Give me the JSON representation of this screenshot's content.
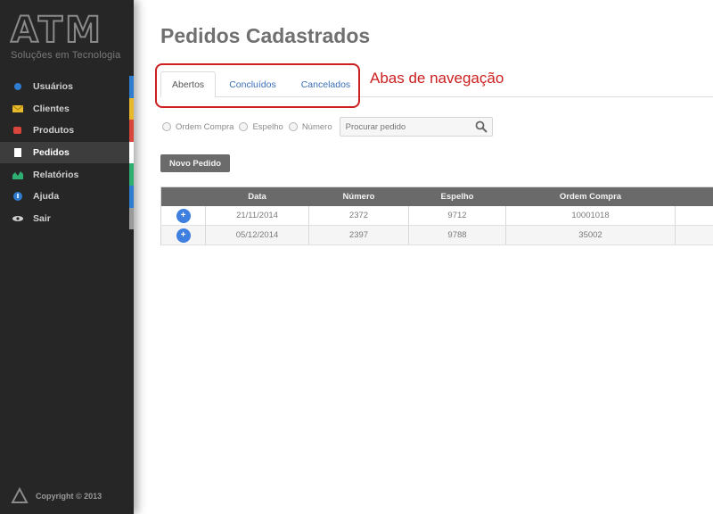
{
  "sidebar": {
    "logo_text": "ATM",
    "logo_subtitle": "Soluções em Tecnologia",
    "items": [
      {
        "label": "Usuários",
        "icon": "user-icon",
        "color": "#2f7dd1",
        "active": false
      },
      {
        "label": "Clientes",
        "icon": "envelope-icon",
        "color": "#e8b92b",
        "active": false
      },
      {
        "label": "Produtos",
        "icon": "tag-icon",
        "color": "#d9463b",
        "active": false
      },
      {
        "label": "Pedidos",
        "icon": "document-icon",
        "color": "#ffffff",
        "active": true
      },
      {
        "label": "Relatórios",
        "icon": "chart-icon",
        "color": "#2fae72",
        "active": false
      },
      {
        "label": "Ajuda",
        "icon": "help-icon",
        "color": "#2f7dd1",
        "active": false
      },
      {
        "label": "Sair",
        "icon": "eye-icon",
        "color": "#9a9a9a",
        "active": false
      }
    ],
    "copyright": "Copyright © 2013"
  },
  "main": {
    "title": "Pedidos Cadastrados",
    "tabs": [
      {
        "label": "Abertos",
        "active": true
      },
      {
        "label": "Concluídos",
        "active": false
      },
      {
        "label": "Cancelados",
        "active": false
      }
    ],
    "annotation": {
      "label": "Abas de navegação",
      "color": "#cc1f1f"
    },
    "filters": {
      "options": [
        "Ordem Compra",
        "Espelho",
        "Número"
      ],
      "search_placeholder": "Procurar pedido"
    },
    "new_button_label": "Novo Pedido",
    "table": {
      "columns": [
        "",
        "Data",
        "Número",
        "Espelho",
        "Ordem Compra",
        ""
      ],
      "rows": [
        [
          "",
          "21/11/2014",
          "2372",
          "9712",
          "10001018",
          ""
        ],
        [
          "",
          "05/12/2014",
          "2397",
          "9788",
          "35002",
          ""
        ]
      ]
    }
  }
}
